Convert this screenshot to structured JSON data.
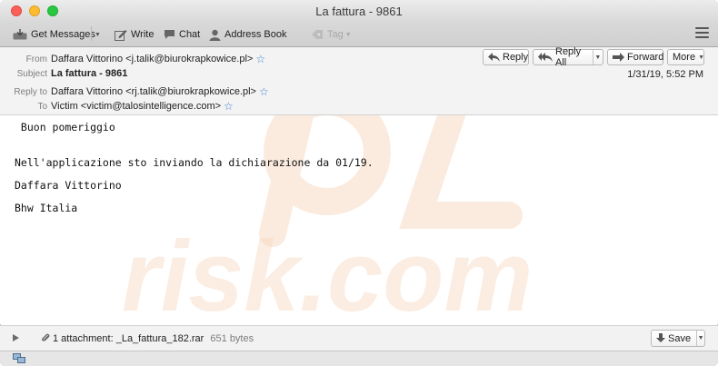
{
  "window": {
    "title": "La fattura - 9861"
  },
  "toolbar": {
    "get_messages": "Get Messages",
    "write": "Write",
    "chat": "Chat",
    "address_book": "Address Book",
    "tag": "Tag"
  },
  "header": {
    "from_label": "From",
    "from_value": "Daffara Vittorino <j.talik@biurokrapkowice.pl>",
    "subject_label": "Subject",
    "subject_value": "La fattura - 9861",
    "reply_to_label": "Reply to",
    "reply_to_value": "Daffara Vittorino <rj.talik@biurokrapkowice.pl>",
    "to_label": "To",
    "to_value": "Victim <victim@talosintelligence.com>",
    "date": "1/31/19, 5:52 PM",
    "buttons": {
      "reply": "Reply",
      "reply_all": "Reply All",
      "forward": "Forward",
      "more": "More"
    }
  },
  "body": {
    "lines": [
      " Buon pomeriggio",
      "Nell'applicazione sto inviando la dichiarazione da 01/19.",
      "Daffara Vittorino",
      "Bhw Italia"
    ]
  },
  "attachment": {
    "summary": "1 attachment: _La_fattura_182.rar",
    "size": "651 bytes",
    "save": "Save"
  },
  "colors": {
    "accent": "#3b82d6",
    "watermark": "#f7d3b8"
  }
}
